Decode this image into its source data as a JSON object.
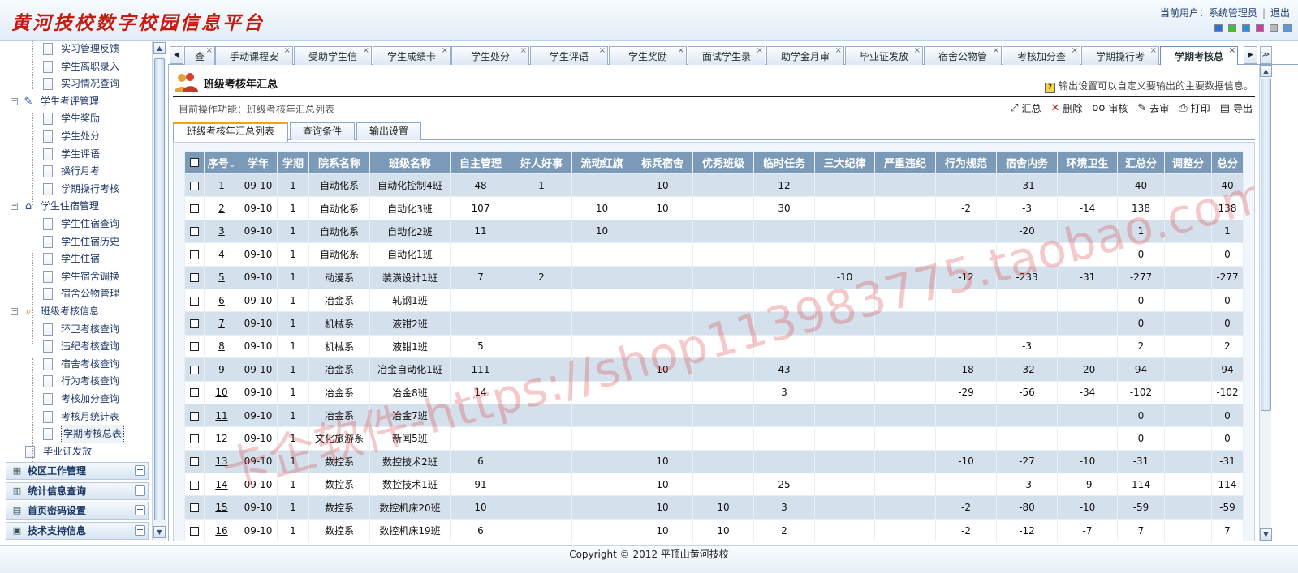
{
  "header": {
    "logo_text": "黄河技校数字校园信息平台",
    "user_label": "当前用户：系统管理员",
    "logout": "退出",
    "skin_colors": [
      "#2f6fd6",
      "#3ac235",
      "#2f8de0",
      "#d23aa4",
      "#b8b8b8",
      "#5a9ae0"
    ]
  },
  "sidebar": {
    "items": [
      {
        "label": "实习管理反馈",
        "type": "leaf"
      },
      {
        "label": "学生离职录入",
        "type": "leaf"
      },
      {
        "label": "实习情况查询",
        "type": "leaf"
      },
      {
        "label": "学生考评管理",
        "type": "group",
        "icon": "clipboard-pen-icon"
      },
      {
        "label": "学生奖励",
        "type": "leaf"
      },
      {
        "label": "学生处分",
        "type": "leaf"
      },
      {
        "label": "学生评语",
        "type": "leaf"
      },
      {
        "label": "操行月考",
        "type": "leaf"
      },
      {
        "label": "学期操行考核",
        "type": "leaf"
      },
      {
        "label": "学生住宿管理",
        "type": "group",
        "icon": "dorm-house-icon"
      },
      {
        "label": "学生住宿查询",
        "type": "leaf"
      },
      {
        "label": "学生住宿历史",
        "type": "leaf"
      },
      {
        "label": "学生住宿",
        "type": "leaf"
      },
      {
        "label": "学生宿舍调换",
        "type": "leaf"
      },
      {
        "label": "宿舍公物管理",
        "type": "leaf"
      },
      {
        "label": "班级考核信息",
        "type": "group",
        "icon": "magnifier-icon"
      },
      {
        "label": "环卫考核查询",
        "type": "leaf"
      },
      {
        "label": "违纪考核查询",
        "type": "leaf"
      },
      {
        "label": "宿舍考核查询",
        "type": "leaf"
      },
      {
        "label": "行为考核查询",
        "type": "leaf"
      },
      {
        "label": "考核加分查询",
        "type": "leaf"
      },
      {
        "label": "考核月统计表",
        "type": "leaf"
      },
      {
        "label": "学期考核总表",
        "type": "leaf",
        "selected": true
      },
      {
        "label": "毕业证发放",
        "type": "leaf",
        "level": 1
      }
    ],
    "accordion": [
      {
        "label": "校区工作管理",
        "icon": "building-icon"
      },
      {
        "label": "统计信息查询",
        "icon": "chart-icon"
      },
      {
        "label": "首页密码设置",
        "icon": "grid-icon"
      },
      {
        "label": "技术支持信息",
        "icon": "server-icon"
      }
    ]
  },
  "tabs": [
    {
      "label": "查",
      "active": false
    },
    {
      "label": "手动课程安",
      "active": false
    },
    {
      "label": "受助学生信",
      "active": false
    },
    {
      "label": "学生成绩卡",
      "active": false
    },
    {
      "label": "学生处分",
      "active": false
    },
    {
      "label": "学生评语",
      "active": false
    },
    {
      "label": "学生奖励",
      "active": false
    },
    {
      "label": "面试学生录",
      "active": false
    },
    {
      "label": "助学金月审",
      "active": false
    },
    {
      "label": "毕业证发放",
      "active": false
    },
    {
      "label": "宿舍公物管",
      "active": false
    },
    {
      "label": "考核加分查",
      "active": false
    },
    {
      "label": "学期操行考",
      "active": false
    },
    {
      "label": "学期考核总",
      "active": true
    }
  ],
  "page": {
    "title": "班级考核年汇总",
    "tip": "输出设置可以自定义要输出的主要数据信息。",
    "current_op": "目前操作功能：班级考核年汇总列表",
    "toolbar": [
      {
        "label": "汇总",
        "icon": "summary-icon",
        "glyph": "⤢"
      },
      {
        "label": "删除",
        "icon": "delete-icon",
        "glyph": "✕"
      },
      {
        "label": "审核",
        "icon": "audit-glasses-icon",
        "glyph": "oo"
      },
      {
        "label": "去审",
        "icon": "unaudit-clip-icon",
        "glyph": "✎"
      },
      {
        "label": "打印",
        "icon": "print-icon",
        "glyph": "⎙"
      },
      {
        "label": "导出",
        "icon": "export-icon",
        "glyph": "▤"
      }
    ],
    "subtabs": [
      {
        "label": "班级考核年汇总列表",
        "active": true
      },
      {
        "label": "查询条件",
        "active": false
      },
      {
        "label": "输出设置",
        "active": false
      }
    ]
  },
  "table": {
    "columns": [
      "序号",
      "学年",
      "学期",
      "院系名称",
      "班级名称",
      "自主管理",
      "好人好事",
      "流动红旗",
      "标兵宿舍",
      "优秀班级",
      "临时任务",
      "三大纪律",
      "严重违纪",
      "行为规范",
      "宿舍内务",
      "环境卫生",
      "汇总分",
      "调整分",
      "总分"
    ],
    "rows": [
      [
        "1",
        "09-10",
        "1",
        "自动化系",
        "自动化控制4班",
        "48",
        "1",
        "",
        "10",
        "",
        "12",
        "",
        "",
        "",
        "-31",
        "",
        "40",
        "",
        "40"
      ],
      [
        "2",
        "09-10",
        "1",
        "自动化系",
        "自动化3班",
        "107",
        "",
        "10",
        "10",
        "",
        "30",
        "",
        "",
        "-2",
        "-3",
        "-14",
        "138",
        "",
        "138"
      ],
      [
        "3",
        "09-10",
        "1",
        "自动化系",
        "自动化2班",
        "11",
        "",
        "10",
        "",
        "",
        "",
        "",
        "",
        "",
        "-20",
        "",
        "1",
        "",
        "1"
      ],
      [
        "4",
        "09-10",
        "1",
        "自动化系",
        "自动化1班",
        "",
        "",
        "",
        "",
        "",
        "",
        "",
        "",
        "",
        "",
        "",
        "0",
        "",
        "0"
      ],
      [
        "5",
        "09-10",
        "1",
        "动漫系",
        "装潢设计1班",
        "7",
        "2",
        "",
        "",
        "",
        "",
        "-10",
        "",
        "-12",
        "-233",
        "-31",
        "-277",
        "",
        "-277"
      ],
      [
        "6",
        "09-10",
        "1",
        "冶金系",
        "轧钢1班",
        "",
        "",
        "",
        "",
        "",
        "",
        "",
        "",
        "",
        "",
        "",
        "0",
        "",
        "0"
      ],
      [
        "7",
        "09-10",
        "1",
        "机械系",
        "液钳2班",
        "",
        "",
        "",
        "",
        "",
        "",
        "",
        "",
        "",
        "",
        "",
        "0",
        "",
        "0"
      ],
      [
        "8",
        "09-10",
        "1",
        "机械系",
        "液钳1班",
        "5",
        "",
        "",
        "",
        "",
        "",
        "",
        "",
        "",
        "-3",
        "",
        "2",
        "",
        "2"
      ],
      [
        "9",
        "09-10",
        "1",
        "冶金系",
        "冶金自动化1班",
        "111",
        "",
        "",
        "10",
        "",
        "43",
        "",
        "",
        "-18",
        "-32",
        "-20",
        "94",
        "",
        "94"
      ],
      [
        "10",
        "09-10",
        "1",
        "冶金系",
        "冶金8班",
        "14",
        "",
        "",
        "",
        "",
        "3",
        "",
        "",
        "-29",
        "-56",
        "-34",
        "-102",
        "",
        "-102"
      ],
      [
        "11",
        "09-10",
        "1",
        "冶金系",
        "冶金7班",
        "",
        "",
        "",
        "",
        "",
        "",
        "",
        "",
        "",
        "",
        "",
        "0",
        "",
        "0"
      ],
      [
        "12",
        "09-10",
        "1",
        "文化旅游系",
        "新闻5班",
        "",
        "",
        "",
        "",
        "",
        "",
        "",
        "",
        "",
        "",
        "",
        "0",
        "",
        "0"
      ],
      [
        "13",
        "09-10",
        "1",
        "数控系",
        "数控技术2班",
        "6",
        "",
        "",
        "10",
        "",
        "",
        "",
        "",
        "-10",
        "-27",
        "-10",
        "-31",
        "",
        "-31"
      ],
      [
        "14",
        "09-10",
        "1",
        "数控系",
        "数控技术1班",
        "91",
        "",
        "",
        "10",
        "",
        "25",
        "",
        "",
        "",
        "-3",
        "-9",
        "114",
        "",
        "114"
      ],
      [
        "15",
        "09-10",
        "1",
        "数控系",
        "数控机床20班",
        "10",
        "",
        "",
        "10",
        "10",
        "3",
        "",
        "",
        "-2",
        "-80",
        "-10",
        "-59",
        "",
        "-59"
      ],
      [
        "16",
        "09-10",
        "1",
        "数控系",
        "数控机床19班",
        "6",
        "",
        "",
        "10",
        "10",
        "2",
        "",
        "",
        "-2",
        "-12",
        "-7",
        "7",
        "",
        "7"
      ]
    ]
  },
  "watermark": "卡企软件-https://shop113983775.taobao.com",
  "footer": "Copyright © 2012 平顶山黄河技校"
}
